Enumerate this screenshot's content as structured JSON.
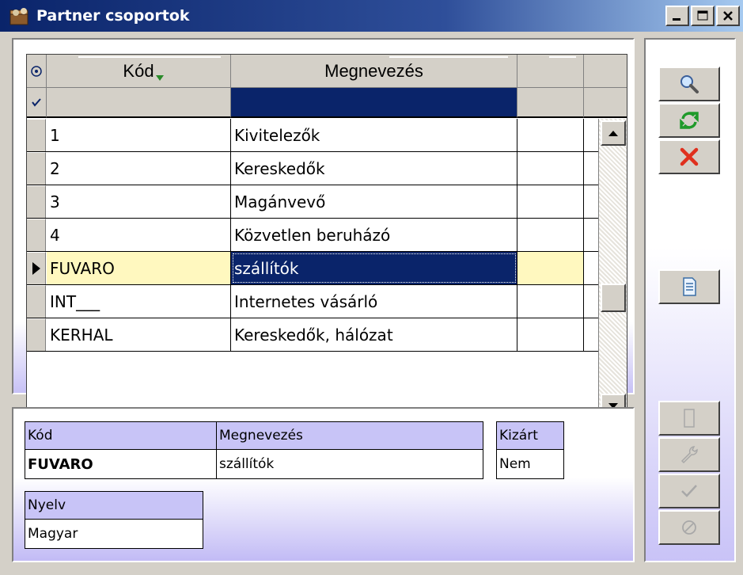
{
  "window": {
    "title": "Partner csoportok",
    "minimize": "_",
    "maximize": "□",
    "close": "×"
  },
  "grid": {
    "columns": [
      "Kód",
      "Megnevezés",
      ""
    ],
    "rows": [
      {
        "kod": "1",
        "megnevezes": "Kivitelezők",
        "extra": ""
      },
      {
        "kod": "2",
        "megnevezes": "Kereskedők",
        "extra": ""
      },
      {
        "kod": "3",
        "megnevezes": "Magánvevő",
        "extra": ""
      },
      {
        "kod": "4",
        "megnevezes": "Közvetlen beruházó",
        "extra": ""
      },
      {
        "kod": "FUVARO",
        "megnevezes": "szállítók",
        "extra": "",
        "selected": true
      },
      {
        "kod": "INT___",
        "megnevezes": "Internetes vásárló",
        "extra": ""
      },
      {
        "kod": "KERHAL",
        "megnevezes": "Kereskedők, hálózat",
        "extra": ""
      }
    ],
    "selected_row_index": 4,
    "scroll_fraction": 0.6
  },
  "detail": {
    "kod_label": "Kód",
    "kod_value": "FUVARO",
    "megnevezes_label": "Megnevezés",
    "megnevezes_value": "szállítók",
    "kizart_label": "Kizárt",
    "kizart_value": "Nem",
    "nyelv_label": "Nyelv",
    "nyelv_value": "Magyar"
  },
  "toolbar": {
    "buttons": [
      {
        "icon": "search-icon",
        "enabled": true
      },
      {
        "icon": "refresh-icon",
        "enabled": true
      },
      {
        "icon": "delete-icon",
        "enabled": true
      },
      {
        "icon": "document-icon",
        "enabled": true
      },
      {
        "icon": "new-page-icon",
        "enabled": false
      },
      {
        "icon": "wrench-icon",
        "enabled": false
      },
      {
        "icon": "check-icon",
        "enabled": false
      },
      {
        "icon": "cancel-icon",
        "enabled": false
      }
    ]
  },
  "colors": {
    "title_bar": "#0a246a",
    "selected_cell": "#0a246a",
    "selected_row": "#fff8bf",
    "label_bg": "#c8c4f7"
  }
}
